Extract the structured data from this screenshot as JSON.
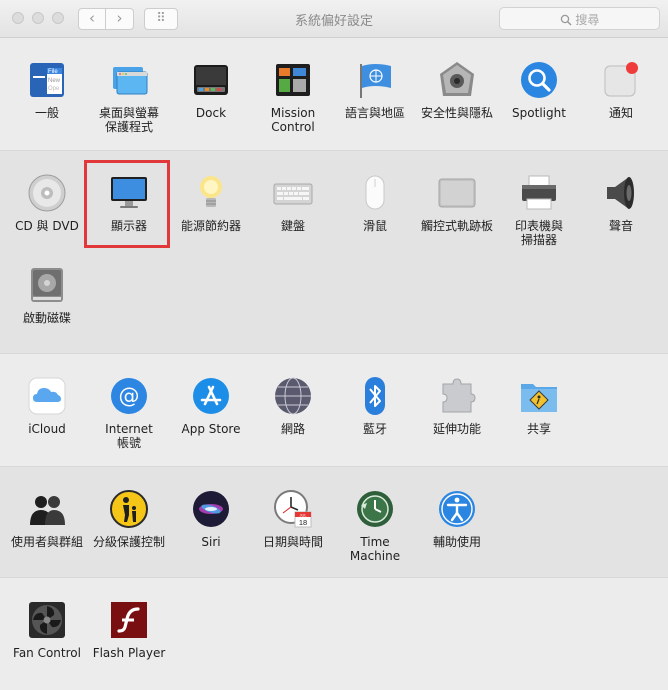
{
  "window": {
    "title": "系統偏好設定",
    "nav_back": "‹",
    "nav_forward": "›",
    "grid": "⠿",
    "search": {
      "placeholder": "搜尋",
      "icon": "search-icon"
    }
  },
  "sections": [
    {
      "items": [
        {
          "label": "一般",
          "icon": "general-icon"
        },
        {
          "label": "桌面與螢幕\n保護程式",
          "icon": "desktop-screensaver-icon"
        },
        {
          "label": "Dock",
          "icon": "dock-icon"
        },
        {
          "label": "Mission\nControl",
          "icon": "mission-control-icon"
        },
        {
          "label": "語言與地區",
          "icon": "language-region-icon"
        },
        {
          "label": "安全性與隱私",
          "icon": "security-privacy-icon"
        },
        {
          "label": "Spotlight",
          "icon": "spotlight-icon"
        },
        {
          "label": "通知",
          "icon": "notifications-icon"
        }
      ]
    },
    {
      "items": [
        {
          "label": "CD 與 DVD",
          "icon": "cd-dvd-icon"
        },
        {
          "label": "顯示器",
          "icon": "displays-icon",
          "highlighted": true
        },
        {
          "label": "能源節約器",
          "icon": "energy-saver-icon"
        },
        {
          "label": "鍵盤",
          "icon": "keyboard-icon"
        },
        {
          "label": "滑鼠",
          "icon": "mouse-icon"
        },
        {
          "label": "觸控式軌跡板",
          "icon": "trackpad-icon"
        },
        {
          "label": "印表機與\n掃描器",
          "icon": "printer-scanner-icon"
        },
        {
          "label": "聲音",
          "icon": "sound-icon"
        },
        {
          "label": "啟動磁碟",
          "icon": "startup-disk-icon"
        }
      ]
    },
    {
      "items": [
        {
          "label": "iCloud",
          "icon": "icloud-icon"
        },
        {
          "label": "Internet\n帳號",
          "icon": "internet-accounts-icon"
        },
        {
          "label": "App Store",
          "icon": "app-store-icon"
        },
        {
          "label": "網路",
          "icon": "network-icon"
        },
        {
          "label": "藍牙",
          "icon": "bluetooth-icon"
        },
        {
          "label": "延伸功能",
          "icon": "extensions-icon"
        },
        {
          "label": "共享",
          "icon": "sharing-icon"
        }
      ]
    },
    {
      "items": [
        {
          "label": "使用者與群組",
          "icon": "users-groups-icon"
        },
        {
          "label": "分級保護控制",
          "icon": "parental-controls-icon"
        },
        {
          "label": "Siri",
          "icon": "siri-icon"
        },
        {
          "label": "日期與時間",
          "icon": "date-time-icon",
          "badge": "JUL\n18"
        },
        {
          "label": "Time Machine",
          "icon": "time-machine-icon"
        },
        {
          "label": "輔助使用",
          "icon": "accessibility-icon"
        }
      ]
    },
    {
      "items": [
        {
          "label": "Fan Control",
          "icon": "fan-control-icon"
        },
        {
          "label": "Flash Player",
          "icon": "flash-player-icon"
        }
      ]
    }
  ]
}
